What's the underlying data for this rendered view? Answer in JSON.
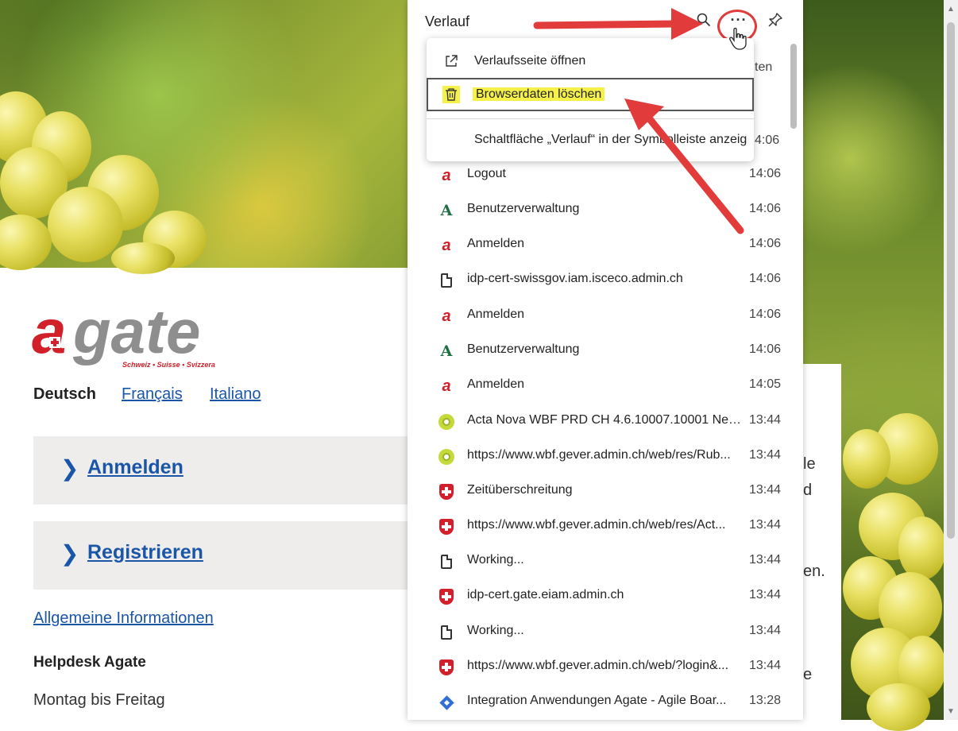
{
  "page": {
    "logo_text": "agate",
    "logo_tagline": "Schweiz • Suisse • Svizzera",
    "languages": [
      {
        "label": "Deutsch",
        "active": true
      },
      {
        "label": "Français",
        "active": false
      },
      {
        "label": "Italiano",
        "active": false
      }
    ],
    "actions": [
      {
        "label": "Anmelden"
      },
      {
        "label": "Registrieren"
      }
    ],
    "info_link": "Allgemeine Informationen",
    "helpdesk_title": "Helpdesk Agate",
    "helpdesk_hours": "Montag bis Freitag",
    "card_fragments": [
      "le",
      "d",
      "en.",
      "e"
    ]
  },
  "history_panel": {
    "title": "Verlauf",
    "header_icons": [
      "search-icon",
      "more-options-icon",
      "pin-icon"
    ],
    "peek_text": [
      "ten",
      "4:06"
    ],
    "menu": {
      "items": [
        {
          "icon": "open-external-icon",
          "label": "Verlaufsseite öffnen"
        },
        {
          "icon": "trash-icon",
          "label": "Browserdaten löschen",
          "highlighted": true
        },
        {
          "icon": "",
          "label": "Schaltfläche „Verlauf“ in der Symbolleiste anzeig"
        }
      ]
    },
    "entries": [
      {
        "icon": "agate",
        "title": "Logout",
        "time": "14:06"
      },
      {
        "icon": "a-green",
        "title": "Benutzerverwaltung",
        "time": "14:06"
      },
      {
        "icon": "agate",
        "title": "Anmelden",
        "time": "14:06"
      },
      {
        "icon": "doc",
        "title": "idp-cert-swissgov.iam.isceco.admin.ch",
        "time": "14:06"
      },
      {
        "icon": "agate",
        "title": "Anmelden",
        "time": "14:06"
      },
      {
        "icon": "a-green",
        "title": "Benutzerverwaltung",
        "time": "14:06"
      },
      {
        "icon": "agate",
        "title": "Anmelden",
        "time": "14:05"
      },
      {
        "icon": "hex",
        "title": "Acta Nova WBF PRD CH 4.6.10007.10001 Neo...",
        "time": "13:44"
      },
      {
        "icon": "hex",
        "title": "https://www.wbf.gever.admin.ch/web/res/Rub...",
        "time": "13:44"
      },
      {
        "icon": "swiss",
        "title": "Zeitüberschreitung",
        "time": "13:44"
      },
      {
        "icon": "swiss",
        "title": "https://www.wbf.gever.admin.ch/web/res/Act...",
        "time": "13:44"
      },
      {
        "icon": "doc",
        "title": "Working...",
        "time": "13:44"
      },
      {
        "icon": "swiss",
        "title": "idp-cert.gate.eiam.admin.ch",
        "time": "13:44"
      },
      {
        "icon": "doc",
        "title": "Working...",
        "time": "13:44"
      },
      {
        "icon": "swiss",
        "title": "https://www.wbf.gever.admin.ch/web/?login&...",
        "time": "13:44"
      },
      {
        "icon": "diamond",
        "title": "Integration Anwendungen Agate - Agile Boar...",
        "time": "13:28"
      }
    ]
  },
  "colors": {
    "agate_red": "#d1202a",
    "link_blue": "#1a56a8",
    "annotation_red": "#e23b3b",
    "highlight_yellow": "#f6f14a"
  }
}
